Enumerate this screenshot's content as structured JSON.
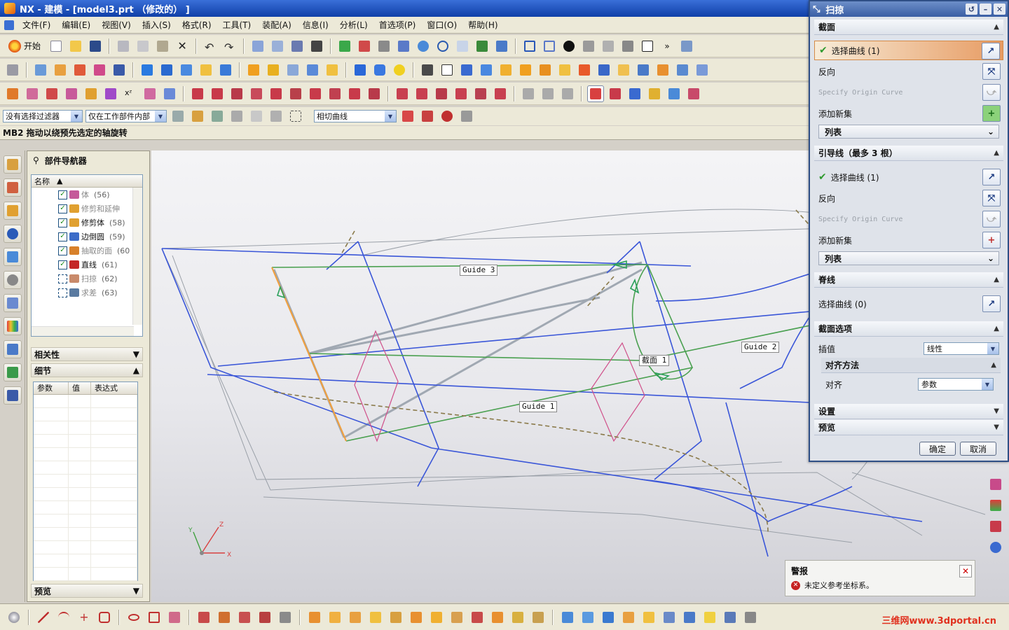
{
  "window": {
    "title": "NX - 建模 - [model3.prt （修改的） ]"
  },
  "menu": [
    "文件(F)",
    "编辑(E)",
    "视图(V)",
    "插入(S)",
    "格式(R)",
    "工具(T)",
    "装配(A)",
    "信息(I)",
    "分析(L)",
    "首选项(P)",
    "窗口(O)",
    "帮助(H)"
  ],
  "toolbar": {
    "start_label": "开始",
    "more_glyph": "»"
  },
  "filters": {
    "selection_filter": "没有选择过滤器",
    "scope": "仅在工作部件内部",
    "curve_rule": "相切曲线"
  },
  "status": {
    "message": "MB2 拖动以绕预先选定的轴旋转"
  },
  "navigator": {
    "title": "部件导航器",
    "column_name": "名称",
    "items": [
      {
        "label": "体",
        "id": "(56)",
        "checked": true,
        "dim": true,
        "color": "#c55a9a"
      },
      {
        "label": "修剪和延伸",
        "id": "",
        "checked": true,
        "dim": true,
        "color": "#e0a030"
      },
      {
        "label": "修剪体",
        "id": "(58)",
        "checked": true,
        "dim": false,
        "color": "#e0a030"
      },
      {
        "label": "边倒圆",
        "id": "(59)",
        "checked": true,
        "dim": false,
        "color": "#3c6cc8"
      },
      {
        "label": "抽取的面",
        "id": "(60",
        "checked": true,
        "dim": true,
        "color": "#d8802a"
      },
      {
        "label": "直线",
        "id": "(61)",
        "checked": true,
        "dim": false,
        "color": "#c42828"
      },
      {
        "label": "扫掠",
        "id": "(62)",
        "checked": false,
        "dim": true,
        "color": "#c98a6a"
      },
      {
        "label": "求差",
        "id": "(63)",
        "checked": false,
        "dim": true,
        "color": "#5a7aa0"
      }
    ],
    "dependencies_label": "相关性",
    "details_label": "细节",
    "details_columns": [
      "参数",
      "值",
      "表达式"
    ],
    "preview_label": "预览"
  },
  "viewport": {
    "labels": {
      "guide3": "Guide 3",
      "guide2": "Guide 2",
      "guide1": "Guide 1",
      "section1": "截面 1"
    },
    "triad": {
      "x": "X",
      "y": "Y",
      "z": "Z"
    }
  },
  "dialog": {
    "title": "扫掠",
    "section": {
      "header": "截面",
      "select_curve": "选择曲线 (1)",
      "reverse": "反向",
      "origin_curve": "Specify Origin Curve",
      "add_new_set": "添加新集",
      "list": "列表"
    },
    "guides": {
      "header": "引导线（最多 3 根）",
      "select_curve": "选择曲线 (1)",
      "reverse": "反向",
      "origin_curve": "Specify Origin Curve",
      "add_new_set": "添加新集",
      "list": "列表"
    },
    "spine": {
      "header": "脊线",
      "select_curve": "选择曲线 (0)"
    },
    "section_options": {
      "header": "截面选项",
      "interpolation_label": "插值",
      "interpolation_value": "线性",
      "alignment_header": "对齐方法",
      "alignment_label": "对齐",
      "alignment_value": "参数"
    },
    "settings": "设置",
    "preview": "预览",
    "ok": "确定",
    "cancel": "取消"
  },
  "alert": {
    "title": "警报",
    "message": "未定义参考坐标系。"
  },
  "watermark": "三维网www.3dportal.cn"
}
